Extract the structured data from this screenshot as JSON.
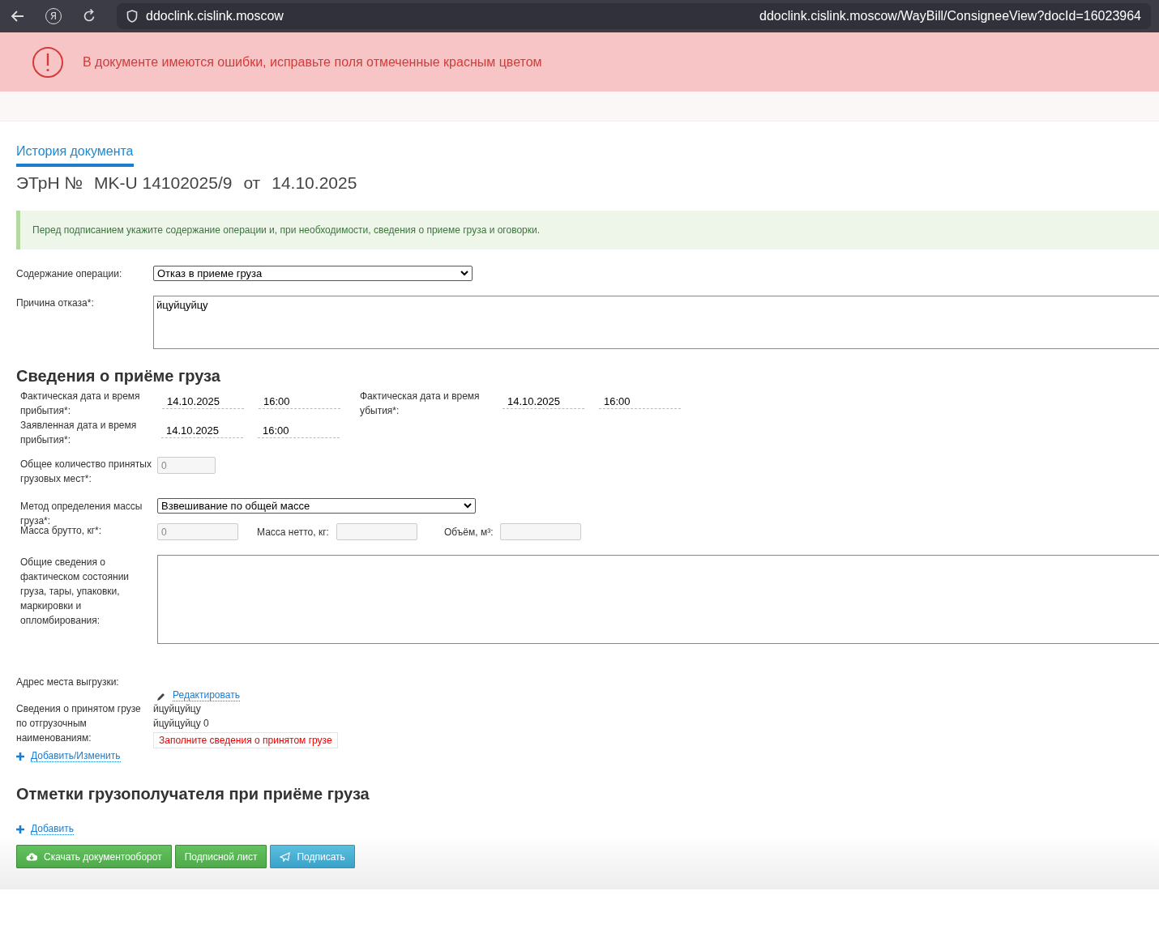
{
  "browser": {
    "logo": "Я",
    "host": "ddoclink.cislink.moscow",
    "url": "ddoclink.cislink.moscow/WayBill/ConsigneeView?docId=16023964"
  },
  "error_banner": {
    "message": "В документе имеются ошибки, исправьте поля отмеченные красным цветом"
  },
  "tabs": [
    {
      "label": "История документа",
      "selected": true
    }
  ],
  "document_heading": {
    "prefix": "ЭТрН №",
    "number": "MK-U 14102025/9",
    "separator": "от",
    "date": "14.10.2025"
  },
  "notice": "Перед подписанием укажите содержание операции и, при необходимости, сведения о приеме груза и оговорки.",
  "operation": {
    "label": "Содержание операции:",
    "value": "Отказ в приеме груза"
  },
  "reason": {
    "label": "Причина отказа*:",
    "value": "йцуйцуйцу"
  },
  "receipt_section": {
    "title": "Сведения о приёме груза"
  },
  "actual_arrival": {
    "label": "Фактическая дата и время прибытия*:",
    "date": "14.10.2025",
    "time": "16:00"
  },
  "actual_departure": {
    "label": "Фактическая дата и время убытия*:",
    "date": "14.10.2025",
    "time": "16:00"
  },
  "declared_arrival": {
    "label": "Заявленная дата и время прибытия*:",
    "date": "14.10.2025",
    "time": "16:00"
  },
  "places": {
    "label": "Общее количество принятых грузовых мест*:",
    "value": "0"
  },
  "mass_method": {
    "label": "Метод определения массы груза*:",
    "value": "Взвешивание по общей массе"
  },
  "gross_mass": {
    "label": "Масса брутто, кг*:",
    "value": "0"
  },
  "net_mass": {
    "label": "Масса нетто, кг:"
  },
  "volume": {
    "label": "Объём, м³:"
  },
  "condition": {
    "label": "Общие сведения о фактическом состоянии груза, тары, упаковки, маркировки и опломбирования:"
  },
  "address": {
    "label": "Адрес места выгрузки:",
    "edit_link": "Редактировать"
  },
  "cargo_info": {
    "label": "Сведения о принятом грузе по отгрузочным наименованиям:",
    "lines": [
      "йцуйцуйцу",
      "йцуйцуйцу 0"
    ],
    "error": "Заполните сведения о принятом грузе",
    "add_link": "Добавить/Изменить"
  },
  "marks_section": {
    "title": "Отметки грузополучателя при приёме груза",
    "add_link": "Добавить"
  },
  "buttons": [
    {
      "label": "Скачать документооборот",
      "kind": "download"
    },
    {
      "label": "Подписной лист",
      "kind": "plain"
    },
    {
      "label": "Подписать",
      "kind": "sign"
    }
  ]
}
